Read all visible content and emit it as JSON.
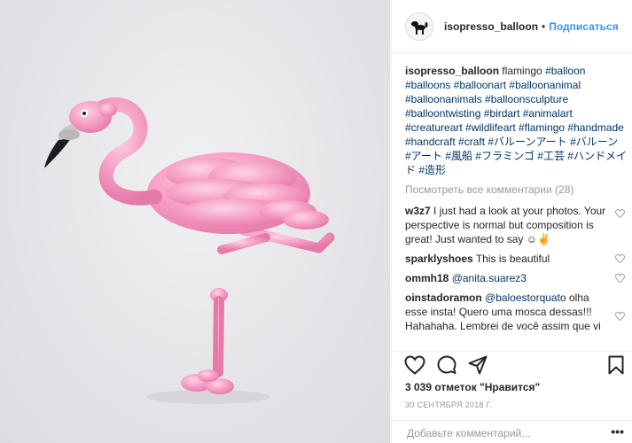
{
  "header": {
    "username": "isopresso_balloon",
    "separator": "•",
    "follow_label": "Подписаться"
  },
  "caption": {
    "username": "isopresso_balloon",
    "text": "flamingo",
    "hashtags": "#balloon #balloons #balloonart #balloonanimal #balloonanimals #balloonsculpture #balloontwisting #birdart #animalart #creatureart #wildlifeart #flamingo #handmade #handcraft #craft #バルーンアート #バルーン #アート #風船 #フラミンゴ #工芸 #ハンドメイド #造形"
  },
  "view_all_comments": "Посмотреть все комментарии (28)",
  "comments": [
    {
      "user": "w3z7",
      "text": "I just had a look at your photos. Your perspective is normal but composition is great! Just wanted to say ☺✌"
    },
    {
      "user": "sparklyshoes",
      "text": "This is beautiful"
    },
    {
      "user": "ommh18",
      "mention": "@anita.suarez3",
      "text": ""
    },
    {
      "user": "oinstadoramon",
      "mention": "@baloestorquato",
      "text": "olha esse insta! Quero uma mosca dessas!!! Hahahaha. Lembrei de você assim que vi"
    }
  ],
  "likes": "3 039 отметок \"Нравится\"",
  "date": "30 СЕНТЯБРЯ 2018 Г.",
  "add_comment_placeholder": "Добавьте комментарий...",
  "more_label": "•••",
  "icons": {
    "like": "heart-icon",
    "comment": "comment-icon",
    "share": "share-icon",
    "save": "bookmark-icon"
  },
  "colors": {
    "link_blue": "#3897f0",
    "hashtag": "#003569",
    "muted": "#999999",
    "flamingo_pink": "#f39cc0"
  }
}
